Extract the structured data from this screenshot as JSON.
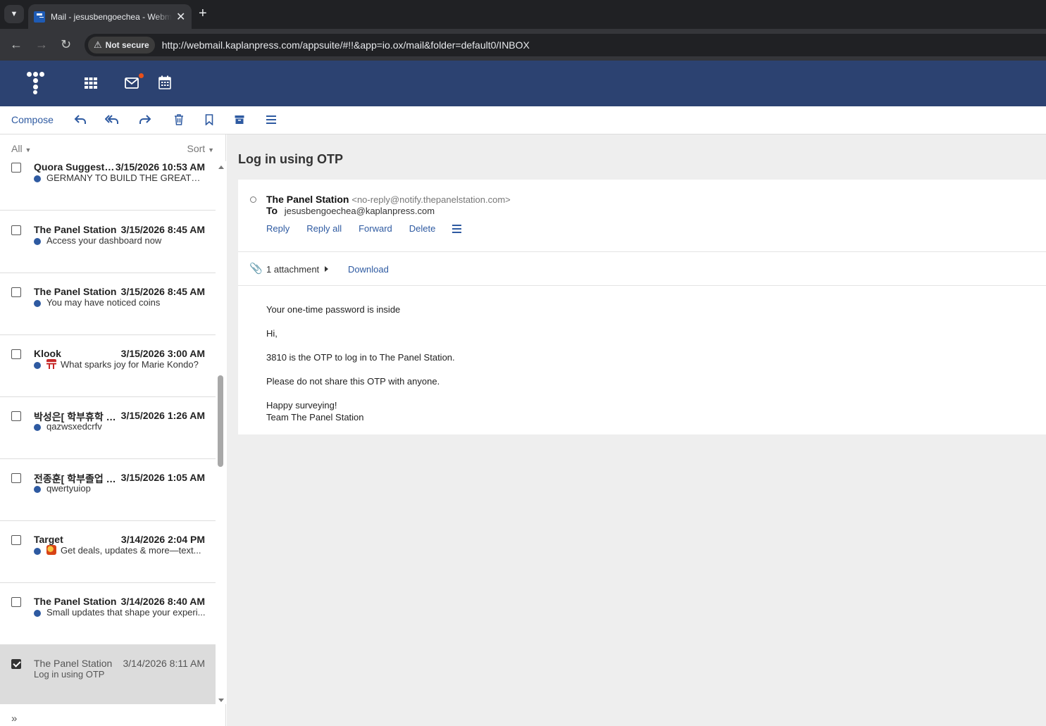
{
  "browser": {
    "tab_title": "Mail - jesusbengoechea - Webmail",
    "security_label": "Not secure",
    "url": "http://webmail.kaplanpress.com/appsuite/#!!&app=io.ox/mail&folder=default0/INBOX"
  },
  "toolbar": {
    "compose_label": "Compose"
  },
  "list": {
    "filter_label": "All",
    "sort_label": "Sort",
    "items": [
      {
        "from": "Quora Suggeste...",
        "date": "3/15/2026 10:53 AM",
        "subject": "GERMANY TO BUILD THE GREATEST ...",
        "unread": true
      },
      {
        "from": "The Panel Station",
        "date": "3/15/2026 8:45 AM",
        "subject": "Access your dashboard now",
        "unread": true
      },
      {
        "from": "The Panel Station",
        "date": "3/15/2026 8:45 AM",
        "subject": "You may have noticed coins",
        "unread": true
      },
      {
        "from": "Klook",
        "date": "3/15/2026 3:00 AM",
        "subject": "What sparks joy for Marie Kondo?",
        "unread": true,
        "emoji": "torii-gate-emoji"
      },
      {
        "from": "박성은[ 학부휴학 / ...",
        "date": "3/15/2026 1:26 AM",
        "subject": "qazwsxedcrfv",
        "unread": true
      },
      {
        "from": "전종훈[ 학부졸업 / ...",
        "date": "3/15/2026 1:05 AM",
        "subject": "qwertyuiop",
        "unread": true
      },
      {
        "from": "Target",
        "date": "3/14/2026 2:04 PM",
        "subject": "Get deals, updates & more—text...",
        "unread": true,
        "emoji": "phone-emoji"
      },
      {
        "from": "The Panel Station",
        "date": "3/14/2026 8:40 AM",
        "subject": "Small updates that shape your experi...",
        "unread": true
      },
      {
        "from": "The Panel Station",
        "date": "3/14/2026 8:11 AM",
        "subject": "Log in using OTP",
        "unread": false,
        "selected": true
      }
    ]
  },
  "message": {
    "subject": "Log in using OTP",
    "sender_name": "The Panel Station",
    "sender_addr": "<no-reply@notify.thepanelstation.com>",
    "to_label": "To",
    "to_addr": "jesusbengoechea@kaplanpress.com",
    "actions": {
      "reply": "Reply",
      "reply_all": "Reply all",
      "forward": "Forward",
      "delete": "Delete"
    },
    "attachment_count": "1 attachment",
    "download_label": "Download",
    "body": {
      "line1": "Your one-time password is inside",
      "line2": "Hi,",
      "line3": "3810 is the OTP to log in to The Panel Station.",
      "line4": "Please do not share this OTP with anyone.",
      "line5": "Happy surveying!",
      "line6": "Team The Panel Station"
    }
  },
  "colors": {
    "header_bg": "#2c4271",
    "accent": "#2e5aa1",
    "unread_dot": "#2e5aa1",
    "notification_dot": "#e8501a"
  }
}
